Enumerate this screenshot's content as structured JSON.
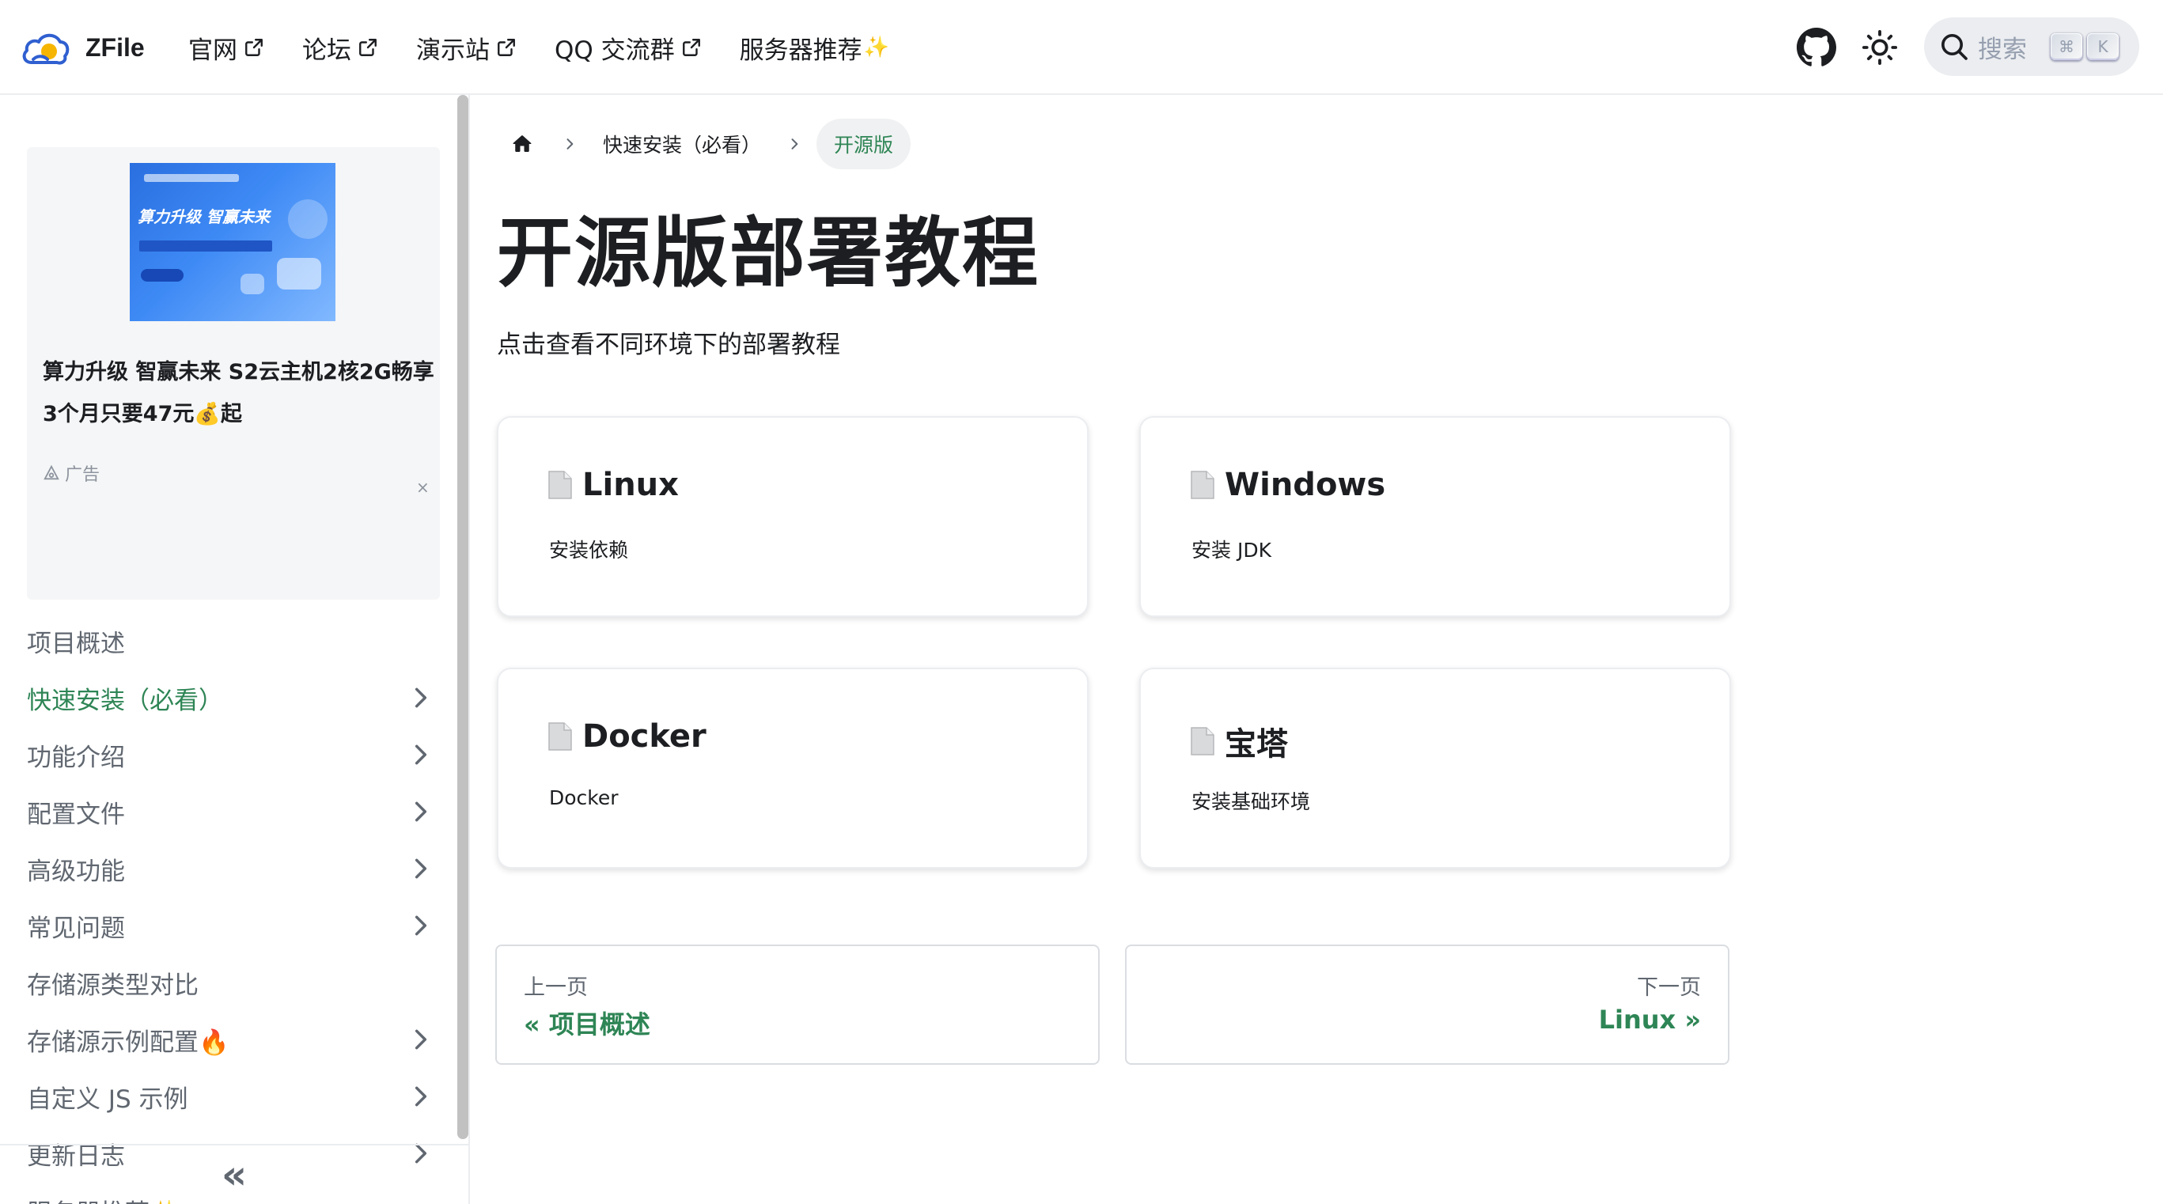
{
  "brand": {
    "name": "ZFile"
  },
  "navbar": {
    "links": [
      {
        "label": "官网",
        "external": true
      },
      {
        "label": "论坛",
        "external": true
      },
      {
        "label": "演示站",
        "external": true
      },
      {
        "label": "QQ 交流群",
        "external": true
      },
      {
        "label": "服务器推荐",
        "sparkle": "✨"
      }
    ],
    "search": {
      "placeholder": "搜索",
      "shortcut": [
        "⌘",
        "K"
      ]
    }
  },
  "sidebar": {
    "ad": {
      "image_headline": "算力升级 智赢未来",
      "text": "算力升级 智赢未来 S2云主机2核2G畅享3个月只要47元💰起",
      "label": "广告",
      "close": "×"
    },
    "items": [
      {
        "label": "项目概述",
        "expandable": false,
        "active": false
      },
      {
        "label": "快速安装（必看）",
        "expandable": true,
        "active": true
      },
      {
        "label": "功能介绍",
        "expandable": true,
        "active": false
      },
      {
        "label": "配置文件",
        "expandable": true,
        "active": false
      },
      {
        "label": "高级功能",
        "expandable": true,
        "active": false
      },
      {
        "label": "常见问题",
        "expandable": true,
        "active": false
      },
      {
        "label": "存储源类型对比",
        "expandable": false,
        "active": false
      },
      {
        "label": "存储源示例配置🔥",
        "expandable": true,
        "active": false
      },
      {
        "label": "自定义 JS 示例",
        "expandable": true,
        "active": false
      },
      {
        "label": "更新日志",
        "expandable": true,
        "active": false
      },
      {
        "label": "服务器推荐✨",
        "expandable": false,
        "active": false
      }
    ],
    "collapse_icon": "«"
  },
  "breadcrumbs": {
    "items": [
      "快速安装（必看）",
      "开源版"
    ]
  },
  "page": {
    "title": "开源版部署教程",
    "description": "点击查看不同环境下的部署教程"
  },
  "cards": [
    {
      "title": "Linux",
      "description": "安装依赖"
    },
    {
      "title": "Windows",
      "description": "安装 JDK"
    },
    {
      "title": "Docker",
      "description": "Docker"
    },
    {
      "title": "宝塔",
      "description": "安装基础环境"
    }
  ],
  "pager": {
    "prev": {
      "sub": "上一页",
      "label": "« 项目概述"
    },
    "next": {
      "sub": "下一页",
      "label": "Linux »"
    }
  },
  "colors": {
    "accent": "#2e8555",
    "text": "#1c1e21",
    "muted": "#606770",
    "border": "#ebedf0"
  }
}
